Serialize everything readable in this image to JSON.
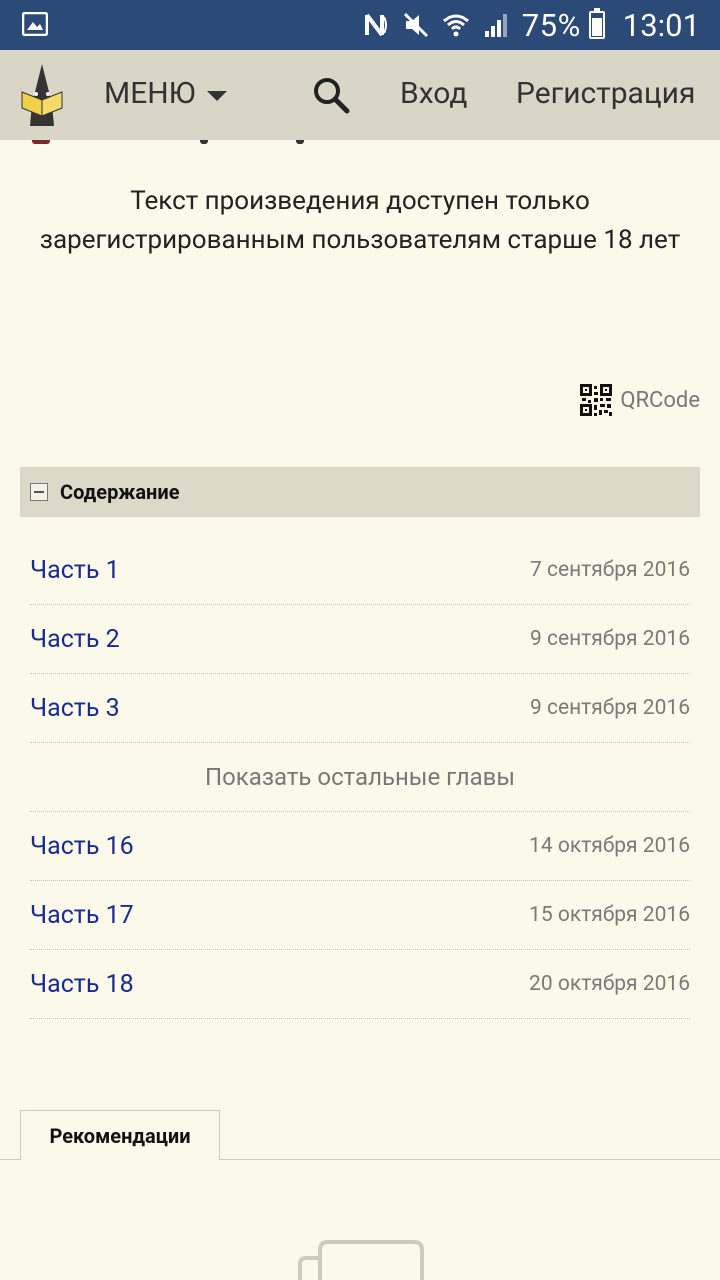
{
  "status_bar": {
    "battery_percent": "75%",
    "time": "13:01",
    "icons": [
      "gallery-icon",
      "nfc-icon",
      "mute-icon",
      "wifi-icon",
      "signal-icon",
      "battery-icon"
    ]
  },
  "header": {
    "menu_label": "МЕНЮ",
    "login_label": "Вход",
    "register_label": "Регистрация",
    "icons": [
      "logo-icon",
      "search-icon",
      "chevron-down-icon"
    ]
  },
  "notice": "Текст произведения доступен только зарегистрированным пользователям старше 18 лет",
  "qr_label": "QRCode",
  "toc": {
    "title": "Содержание",
    "items": [
      {
        "label": "Часть 1",
        "date": "7 сентября 2016"
      },
      {
        "label": "Часть 2",
        "date": "9 сентября 2016"
      },
      {
        "label": "Часть 3",
        "date": "9 сентября 2016"
      }
    ],
    "show_more": "Показать остальные главы",
    "items_after": [
      {
        "label": "Часть 16",
        "date": "14 октября 2016"
      },
      {
        "label": "Часть 17",
        "date": "15 октября 2016"
      },
      {
        "label": "Часть 18",
        "date": "20 октября 2016"
      }
    ]
  },
  "recommendations_tab": "Рекомендации",
  "colors": {
    "status_bar": "#2c4a78",
    "header": "#d9d6c8",
    "background": "#fbf9ea",
    "link": "#1a2a90"
  }
}
